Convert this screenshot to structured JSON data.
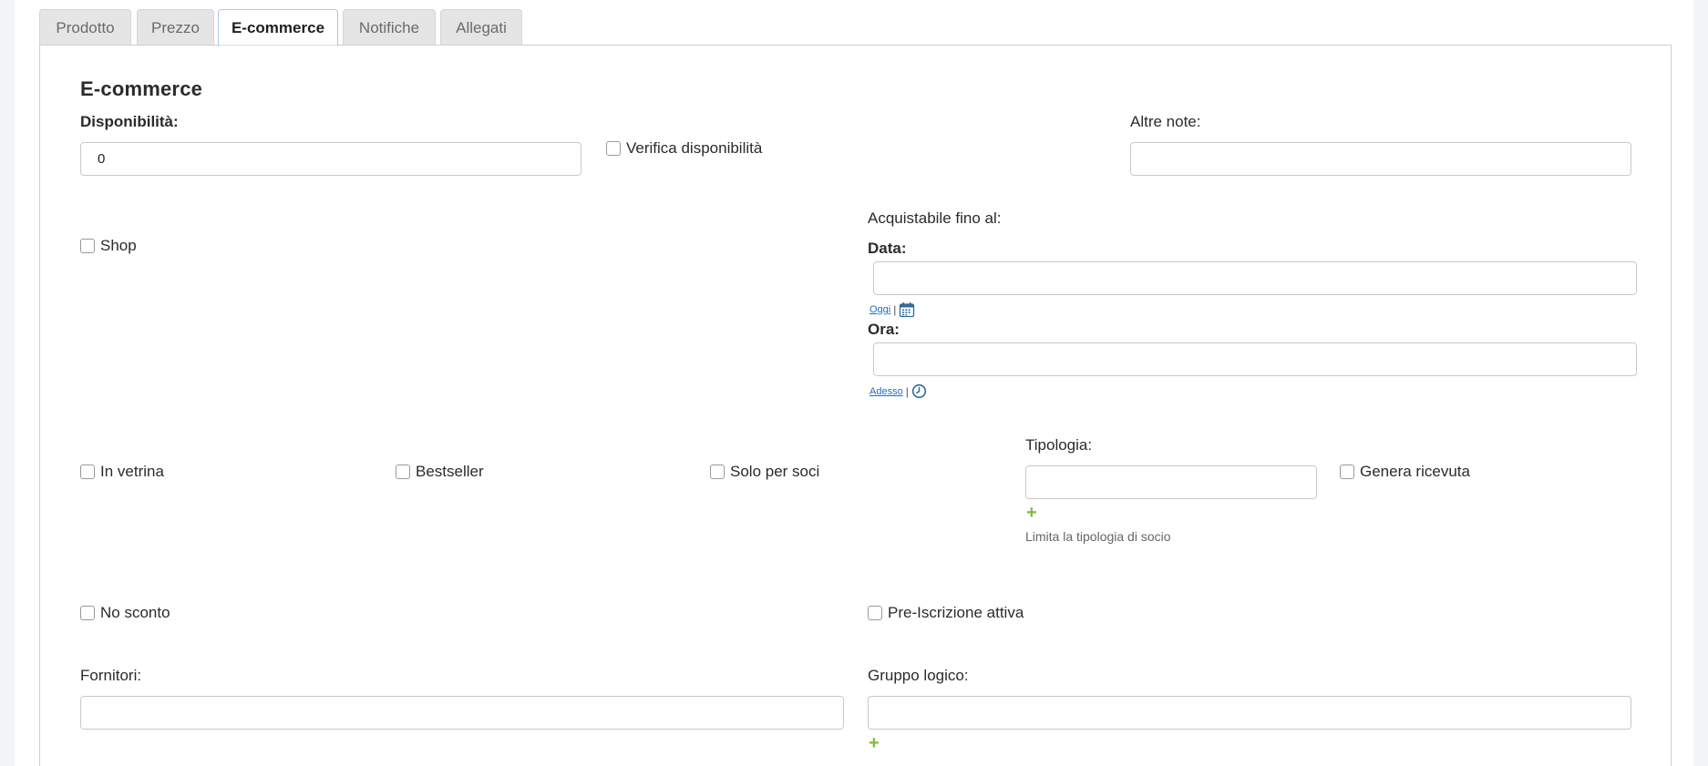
{
  "tabs": [
    {
      "label": "Prodotto"
    },
    {
      "label": "Prezzo"
    },
    {
      "label": "E-commerce"
    },
    {
      "label": "Notifiche"
    },
    {
      "label": "Allegati"
    }
  ],
  "active_tab": "E-commerce",
  "section": {
    "title": "E-commerce"
  },
  "disponibilita": {
    "label": "Disponibilità:",
    "value": "0"
  },
  "verifica_disponibilita": {
    "label": "Verifica disponibilità"
  },
  "altre_note": {
    "label": "Altre note:",
    "value": ""
  },
  "shop": {
    "label": "Shop"
  },
  "acquistabile": {
    "label": "Acquistabile fino al:",
    "data_label": "Data:",
    "data_value": "",
    "oggi_link": "Oggi",
    "ora_label": "Ora:",
    "ora_value": "",
    "adesso_link": "Adesso",
    "separator": "|"
  },
  "in_vetrina": {
    "label": "In vetrina"
  },
  "bestseller": {
    "label": "Bestseller"
  },
  "solo_per_soci": {
    "label": "Solo per soci"
  },
  "tipologia": {
    "label": "Tipologia:",
    "value": "",
    "add": "+",
    "help": "Limita la tipologia di socio"
  },
  "genera_ricevuta": {
    "label": "Genera ricevuta"
  },
  "no_sconto": {
    "label": "No sconto"
  },
  "pre_iscrizione": {
    "label": "Pre-Iscrizione attiva"
  },
  "fornitori": {
    "label": "Fornitori:",
    "value": ""
  },
  "gruppo_logico": {
    "label": "Gruppo logico:",
    "value": "",
    "add": "+"
  },
  "colors": {
    "link": "#1e6fc4",
    "add": "#7cbd3d",
    "active_tab_border": "#a9c9ea"
  }
}
